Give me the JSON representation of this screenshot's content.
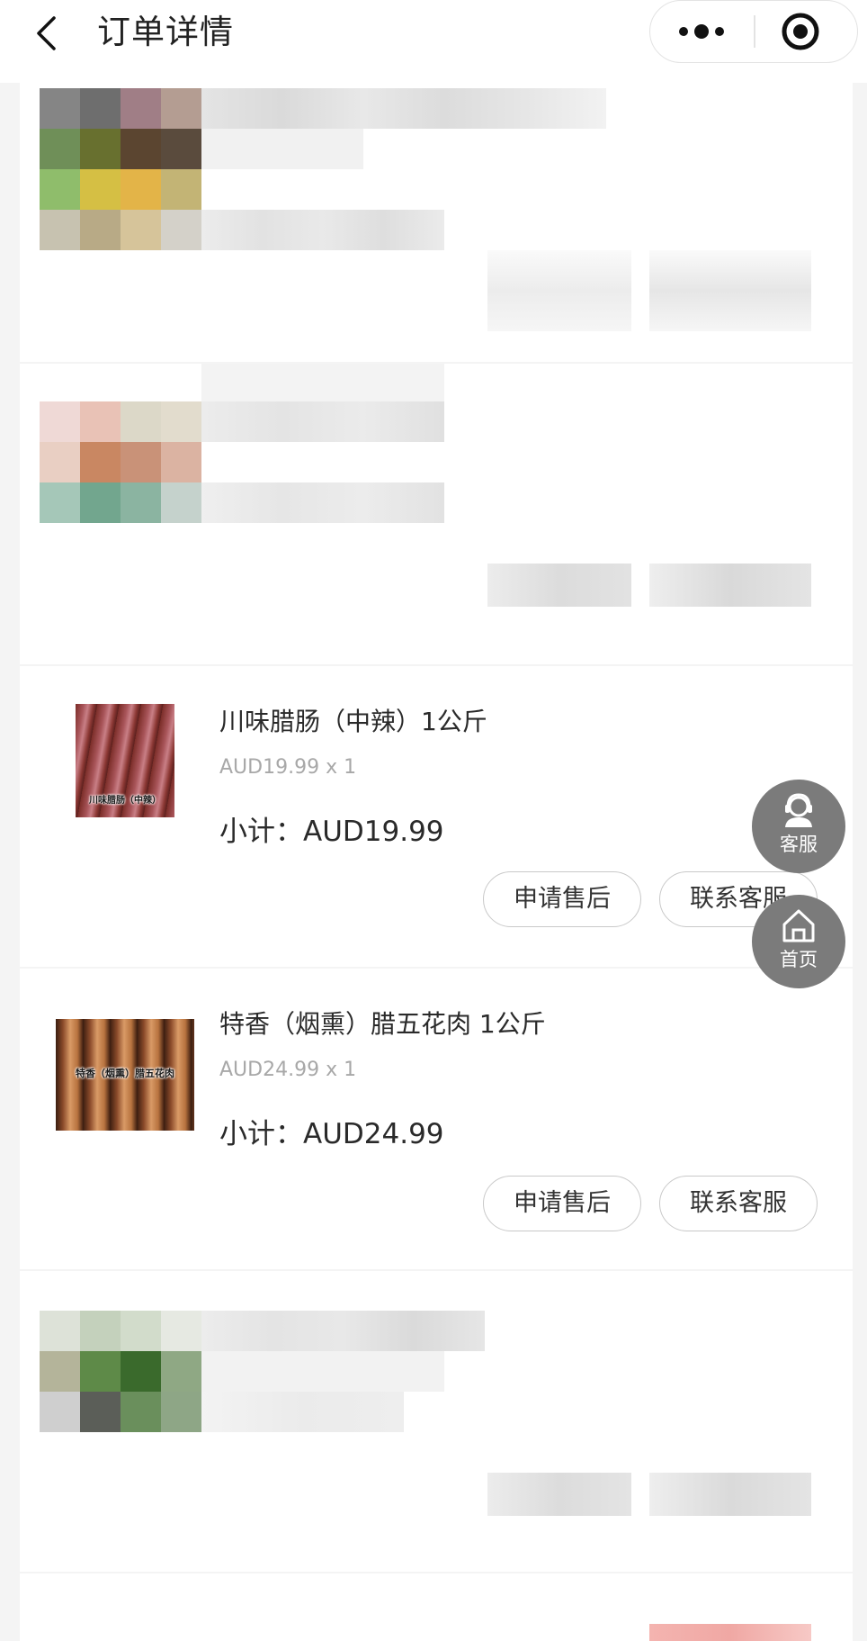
{
  "navbar": {
    "back_icon": "chevron-left-icon",
    "title": "订单详情",
    "more_icon": "more-dots-icon",
    "close_icon": "target-circle-icon"
  },
  "items": [
    {
      "product_name": "川味腊肠（中辣）1公斤",
      "image_caption": "川味腊肠（中辣）",
      "unit_price": "AUD19.99 x 1",
      "subtotal": "小计：AUD19.99",
      "after_sale_label": "申请售后",
      "contact_label": "联系客服"
    },
    {
      "product_name": "特香（烟熏）腊五花肉 1公斤",
      "image_caption": "特香（烟熏）腊五花肉",
      "unit_price": "AUD24.99 x 1",
      "subtotal": "小计：AUD24.99",
      "after_sale_label": "申请售后",
      "contact_label": "联系客服"
    }
  ],
  "floating": {
    "service_label": "客服",
    "service_icon": "customer-service-icon",
    "home_label": "首页",
    "home_icon": "home-icon"
  },
  "colors": {
    "float_button_bg": "#7b7b7b",
    "pill_border": "#c9c9c9",
    "price_gray": "#a8a8a8",
    "page_bg": "#f4f4f4"
  }
}
